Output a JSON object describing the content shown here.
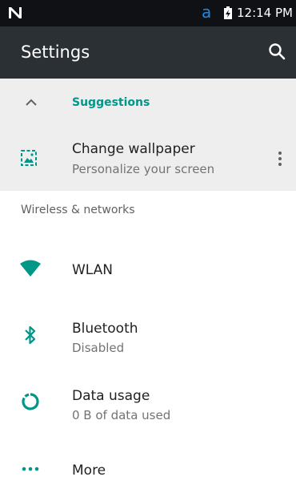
{
  "status_bar": {
    "time": "12:14 PM",
    "app_notification_glyph": "a",
    "icons": [
      "n-logo-icon",
      "a-notification-icon",
      "battery-charging-icon"
    ]
  },
  "app_bar": {
    "title": "Settings",
    "search_icon": "search-icon"
  },
  "suggestions": {
    "header": "Suggestions",
    "collapse_icon": "chevron-up-icon",
    "items": [
      {
        "title": "Change wallpaper",
        "subtitle": "Personalize your screen",
        "icon": "wallpaper-icon",
        "menu_icon": "more-vert-icon"
      }
    ]
  },
  "sections": [
    {
      "label": "Wireless & networks",
      "items": [
        {
          "title": "WLAN",
          "subtitle": "",
          "icon": "wifi-icon"
        },
        {
          "title": "Bluetooth",
          "subtitle": "Disabled",
          "icon": "bluetooth-icon"
        },
        {
          "title": "Data usage",
          "subtitle": "0 B of data used",
          "icon": "data-usage-icon"
        },
        {
          "title": "More",
          "subtitle": "",
          "icon": "more-horiz-icon"
        }
      ]
    }
  ],
  "colors": {
    "accent": "#009688",
    "status_bar": "#0f1115",
    "app_bar": "#2b3035",
    "suggestion_bg": "#eeeeee",
    "notification_blue": "#1e88e5"
  }
}
